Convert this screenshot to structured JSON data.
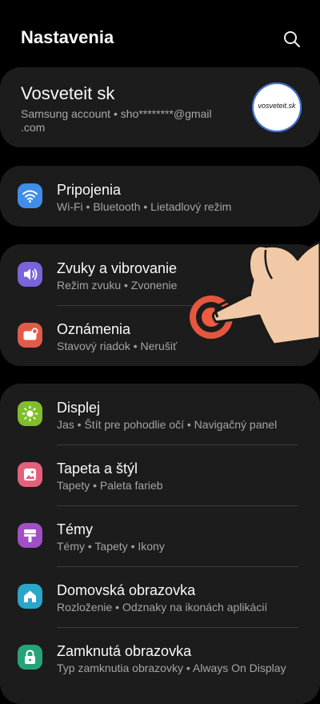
{
  "header": {
    "title": "Nastavenia",
    "search_icon": "search-icon"
  },
  "account": {
    "name": "Vosveteit sk",
    "sub_line1": "Samsung account  •  sho********@gmail",
    "sub_line2": ".com",
    "avatar_text": "vosveteit.sk"
  },
  "sections": [
    {
      "items": [
        {
          "title": "Pripojenia",
          "subtitle": "Wi-Fi  •  Bluetooth  •  Lietadlový režim",
          "icon": "wifi-icon",
          "color": "#3f8fe8"
        }
      ]
    },
    {
      "items": [
        {
          "title": "Zvuky a vibrovanie",
          "subtitle": "Režim zvuku  •  Zvonenie",
          "icon": "sound-icon",
          "color": "#7b63d9"
        },
        {
          "title": "Oznámenia",
          "subtitle": "Stavový riadok  •  Nerušiť",
          "icon": "notification-icon",
          "color": "#e15a4a"
        }
      ]
    },
    {
      "items": [
        {
          "title": "Displej",
          "subtitle": "Jas  •  Štít pre pohodlie očí  •  Navigačný panel",
          "icon": "brightness-icon",
          "color": "#7fbf2b"
        },
        {
          "title": "Tapeta a štýl",
          "subtitle": "Tapety  •  Paleta farieb",
          "icon": "wallpaper-icon",
          "color": "#e4607a"
        },
        {
          "title": "Témy",
          "subtitle": "Témy  •  Tapety  •  Ikony",
          "icon": "themes-icon",
          "color": "#a04fc4"
        },
        {
          "title": "Domovská obrazovka",
          "subtitle": "Rozloženie  •  Odznaky na ikonách aplikácií",
          "icon": "home-icon",
          "color": "#2aa6c9"
        },
        {
          "title": "Zamknutá obrazovka",
          "subtitle": "Typ zamknutia obrazovky  •  Always On Display",
          "icon": "lock-icon",
          "color": "#27a37a"
        }
      ]
    }
  ],
  "overlay": {
    "icon": "tap-hand-icon",
    "ring_color": "#f05a40"
  }
}
